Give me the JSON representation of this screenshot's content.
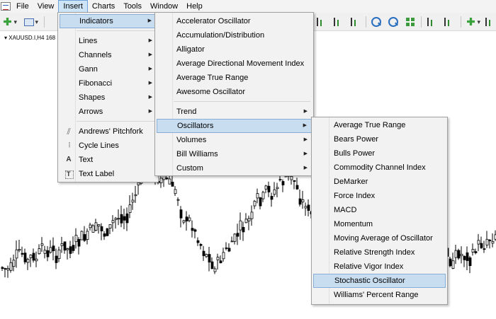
{
  "menubar": {
    "items": [
      "File",
      "View",
      "Insert",
      "Charts",
      "Tools",
      "Window",
      "Help"
    ],
    "open_item": "Insert"
  },
  "chart": {
    "title": "XAUUSD.I,H4",
    "title_suffix": "168"
  },
  "insert_menu": {
    "items": [
      {
        "label": "Indicators",
        "submenu": true,
        "highlighted": true
      },
      {
        "label": "Lines",
        "submenu": true
      },
      {
        "label": "Channels",
        "submenu": true
      },
      {
        "label": "Gann",
        "submenu": true
      },
      {
        "label": "Fibonacci",
        "submenu": true
      },
      {
        "label": "Shapes",
        "submenu": true
      },
      {
        "label": "Arrows",
        "submenu": true
      },
      {
        "label": "Andrews' Pitchfork",
        "icon": "pitchfork-icon"
      },
      {
        "label": "Cycle Lines",
        "icon": "cycle-lines-icon"
      },
      {
        "label": "Text",
        "icon": "text-icon",
        "icon_glyph": "A"
      },
      {
        "label": "Text Label",
        "icon": "text-label-icon"
      }
    ]
  },
  "indicators_menu": {
    "items": [
      {
        "label": "Accelerator Oscillator"
      },
      {
        "label": "Accumulation/Distribution"
      },
      {
        "label": "Alligator"
      },
      {
        "label": "Average Directional Movement Index"
      },
      {
        "label": "Average True Range"
      },
      {
        "label": "Awesome Oscillator"
      },
      {
        "label": "Trend",
        "submenu": true
      },
      {
        "label": "Oscillators",
        "submenu": true,
        "highlighted": true
      },
      {
        "label": "Volumes",
        "submenu": true
      },
      {
        "label": "Bill Williams",
        "submenu": true
      },
      {
        "label": "Custom",
        "submenu": true
      }
    ]
  },
  "oscillators_menu": {
    "items": [
      {
        "label": "Average True Range"
      },
      {
        "label": "Bears Power"
      },
      {
        "label": "Bulls Power"
      },
      {
        "label": "Commodity Channel Index"
      },
      {
        "label": "DeMarker"
      },
      {
        "label": "Force Index"
      },
      {
        "label": "MACD"
      },
      {
        "label": "Momentum"
      },
      {
        "label": "Moving Average of Oscillator"
      },
      {
        "label": "Relative Strength Index"
      },
      {
        "label": "Relative Vigor Index"
      },
      {
        "label": "Stochastic Oscillator",
        "highlighted": true
      },
      {
        "label": "Williams' Percent Range"
      }
    ]
  },
  "icons": {
    "submenu_arrow": "▶"
  },
  "colors": {
    "menu_highlight": "#c9ddf1",
    "menu_highlight_border": "#87aed6",
    "candle": "#000000"
  }
}
